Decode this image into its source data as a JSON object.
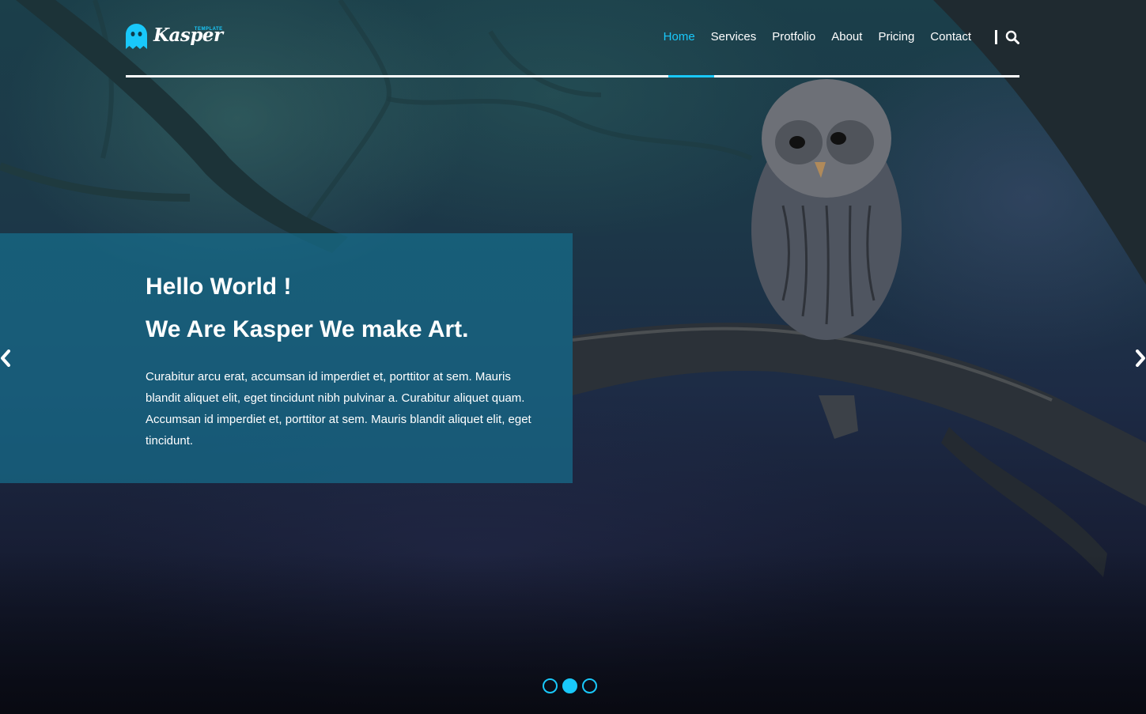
{
  "brand": {
    "name": "Kasper",
    "tag": "TEMPLATE",
    "accent": "#19c8fa",
    "icon": "ghost-icon"
  },
  "nav": {
    "items": [
      {
        "label": "Home",
        "active": true
      },
      {
        "label": "Services",
        "active": false
      },
      {
        "label": "Protfolio",
        "active": false
      },
      {
        "label": "About",
        "active": false
      },
      {
        "label": "Pricing",
        "active": false
      },
      {
        "label": "Contact",
        "active": false
      }
    ],
    "search_icon": "search-icon"
  },
  "slide": {
    "title": "Hello World !",
    "subtitle": "We Are Kasper We make Art.",
    "body": "Curabitur arcu erat, accumsan id imperdiet et, porttitor at sem. Mauris blandit aliquet elit, eget tincidunt nibh pulvinar a. Curabitur aliquet quam. Accumsan id imperdiet et, porttitor at sem. Mauris blandit aliquet elit, eget tincidunt.",
    "box_color": "#166e8c"
  },
  "slider": {
    "prev_icon": "chevron-left-icon",
    "next_icon": "chevron-right-icon",
    "bullet_count": 3,
    "active_bullet": 2
  }
}
